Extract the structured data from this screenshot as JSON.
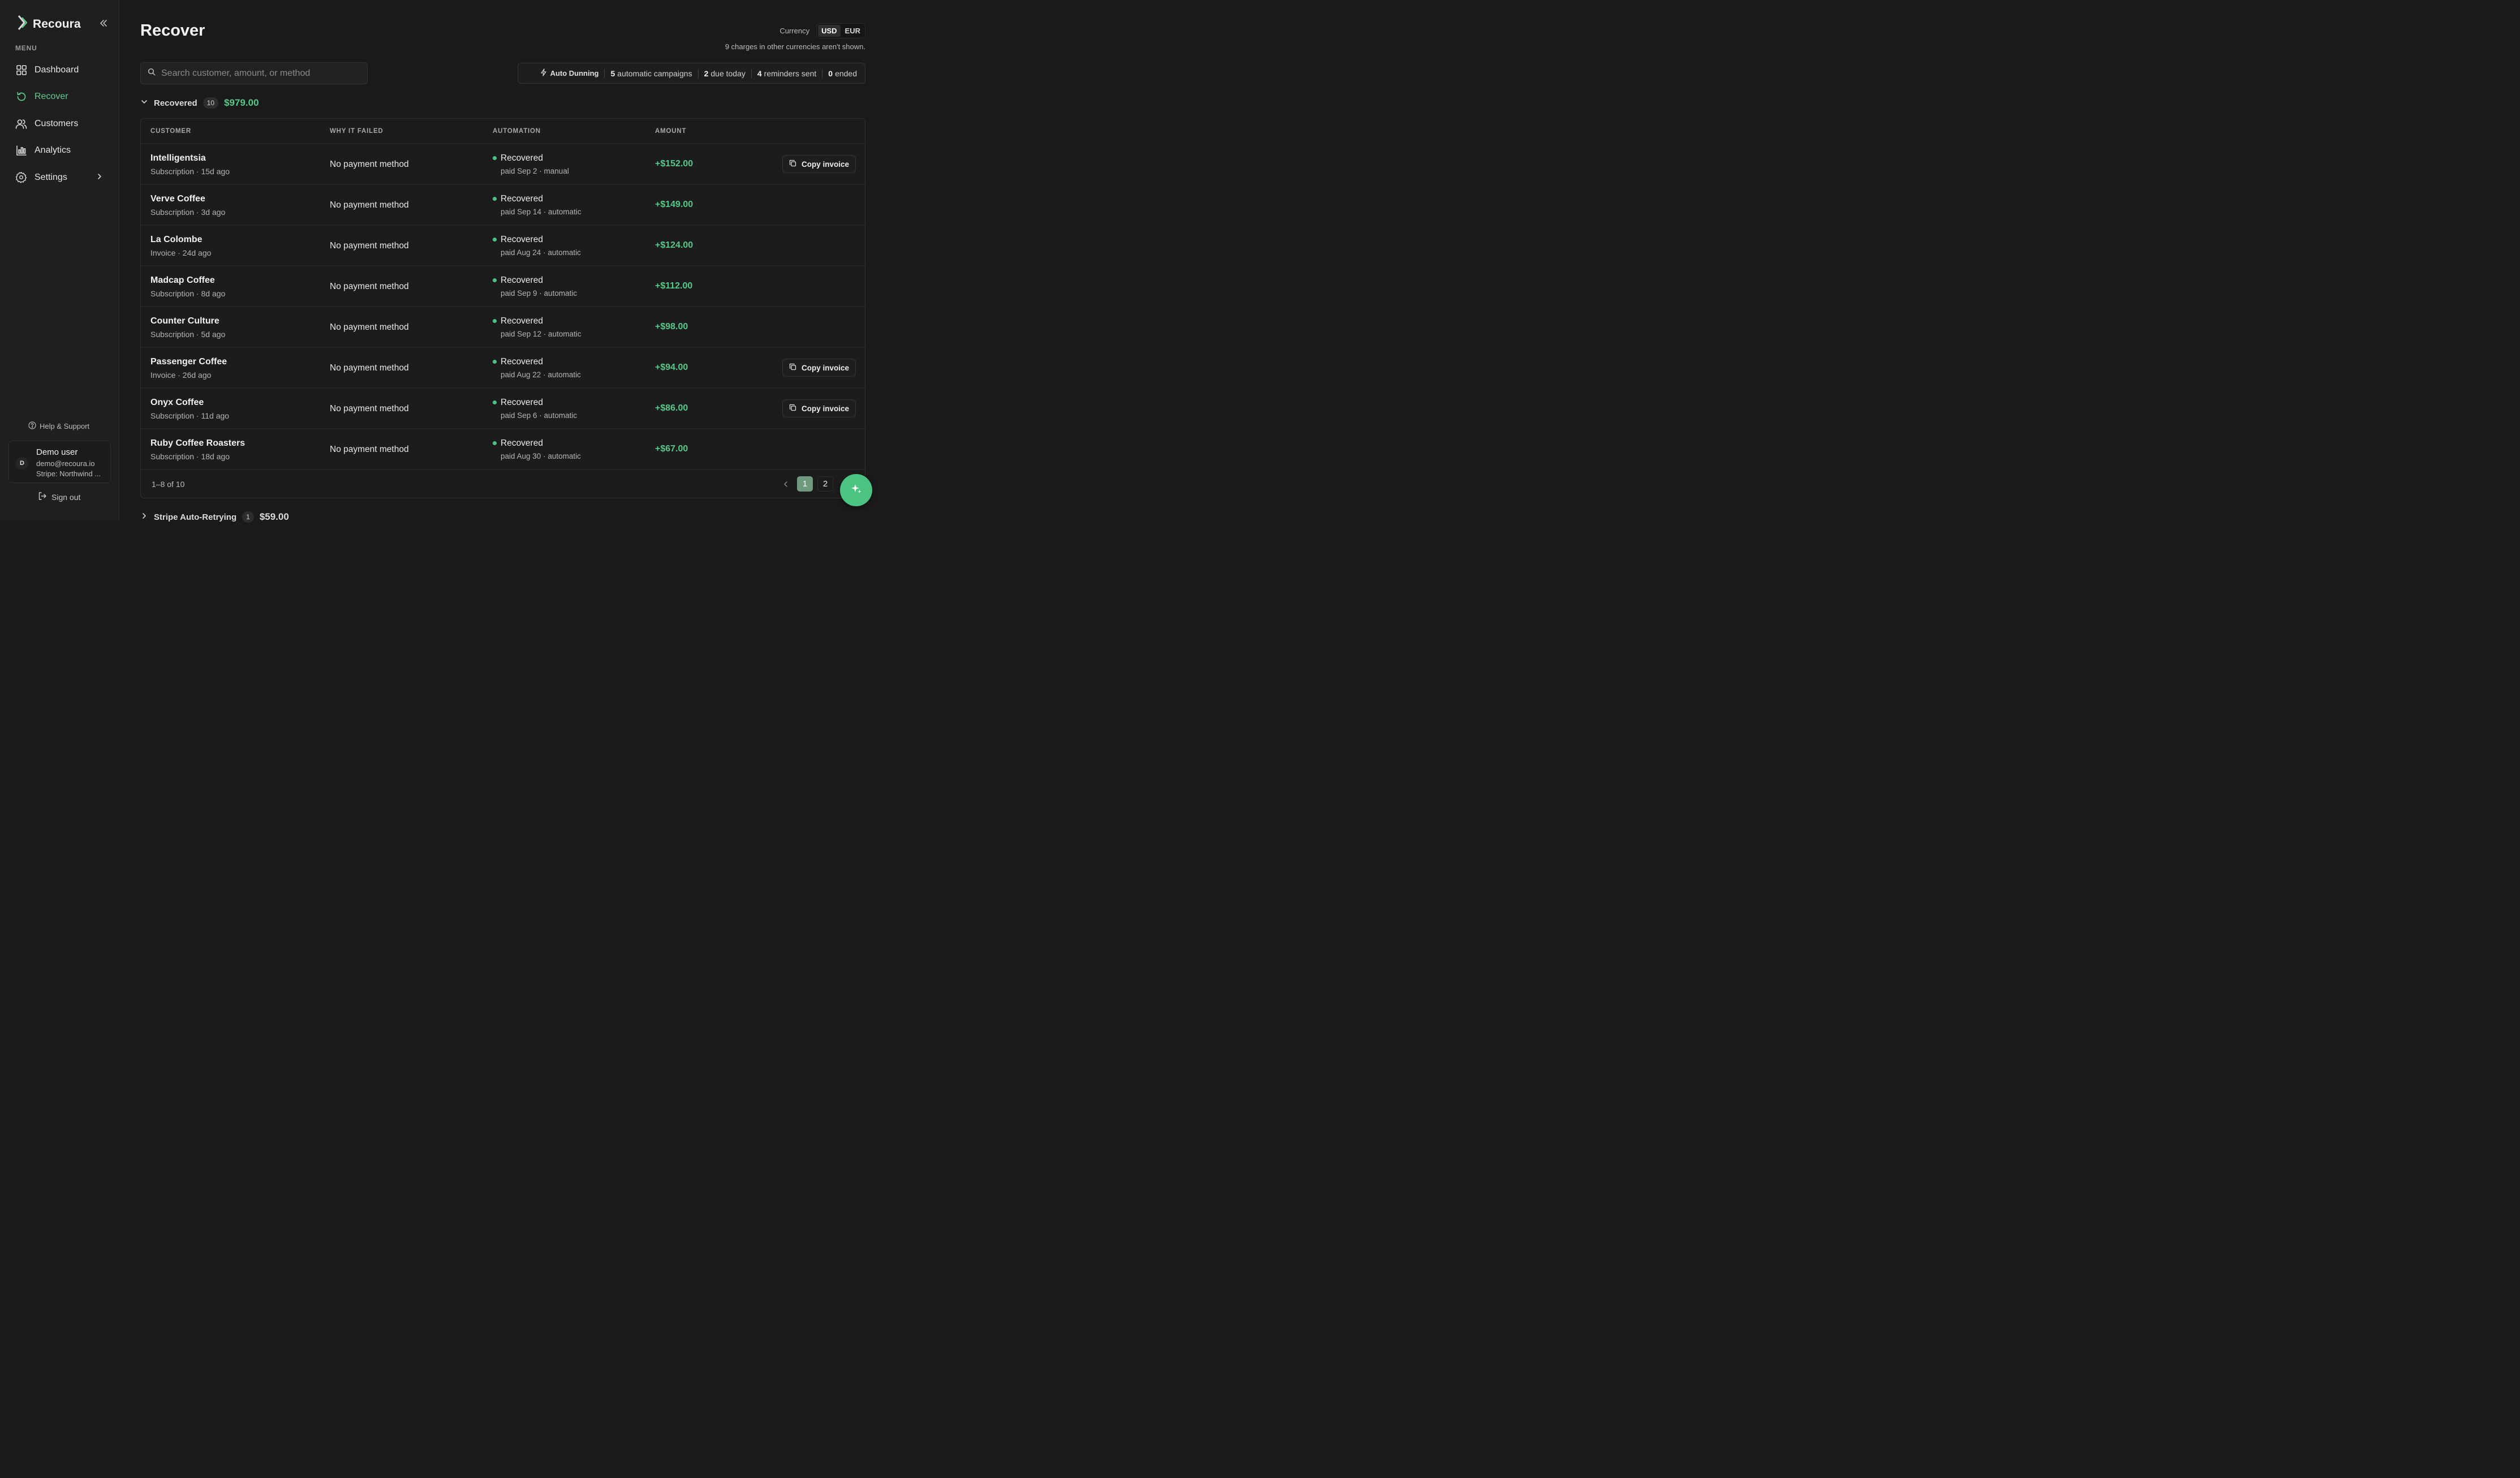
{
  "brand": {
    "name": "Recoura"
  },
  "sidebar": {
    "menu_label": "MENU",
    "items": [
      {
        "label": "Dashboard",
        "icon": "grid-icon"
      },
      {
        "label": "Recover",
        "icon": "refresh-icon"
      },
      {
        "label": "Customers",
        "icon": "users-icon"
      },
      {
        "label": "Analytics",
        "icon": "bar-chart-icon"
      },
      {
        "label": "Settings",
        "icon": "gear-icon"
      }
    ],
    "active": "Recover",
    "help_label": "Help & Support",
    "user": {
      "initial": "D",
      "name": "Demo user",
      "email": "demo@recoura.io",
      "stripe": "Stripe: Northwind ..."
    },
    "signout_label": "Sign out"
  },
  "page": {
    "title": "Recover",
    "currency": {
      "label": "Currency",
      "options": [
        "USD",
        "EUR"
      ],
      "selected": "USD",
      "note": "9 charges in other currencies aren't shown."
    },
    "search": {
      "placeholder": "Search customer, amount, or method",
      "value": ""
    },
    "dunning": {
      "label": "Auto Dunning",
      "campaigns_count": "5",
      "campaigns_text": "automatic campaigns",
      "due_count": "2",
      "due_text": "due today",
      "reminders_count": "4",
      "reminders_text": "reminders sent",
      "ended_count": "0",
      "ended_text": "ended"
    }
  },
  "groups": [
    {
      "title": "Recovered",
      "count": "10",
      "total": "$979.00",
      "expanded": true
    },
    {
      "title": "Stripe Auto-Retrying",
      "count": "1",
      "total": "$59.00",
      "expanded": false
    }
  ],
  "table": {
    "columns": [
      "CUSTOMER",
      "WHY IT FAILED",
      "AUTOMATION",
      "AMOUNT"
    ],
    "copy_label": "Copy invoice",
    "rows": [
      {
        "customer": "Intelligentsia",
        "meta": "Subscription · 15d ago",
        "failed": "No payment method",
        "status": "Recovered",
        "auto_meta": "paid Sep 2 · manual",
        "amount": "+$152.00",
        "copy": true
      },
      {
        "customer": "Verve Coffee",
        "meta": "Subscription · 3d ago",
        "failed": "No payment method",
        "status": "Recovered",
        "auto_meta": "paid Sep 14 · automatic",
        "amount": "+$149.00",
        "copy": false
      },
      {
        "customer": "La Colombe",
        "meta": "Invoice · 24d ago",
        "failed": "No payment method",
        "status": "Recovered",
        "auto_meta": "paid Aug 24 · automatic",
        "amount": "+$124.00",
        "copy": false
      },
      {
        "customer": "Madcap Coffee",
        "meta": "Subscription · 8d ago",
        "failed": "No payment method",
        "status": "Recovered",
        "auto_meta": "paid Sep 9 · automatic",
        "amount": "+$112.00",
        "copy": false
      },
      {
        "customer": "Counter Culture",
        "meta": "Subscription · 5d ago",
        "failed": "No payment method",
        "status": "Recovered",
        "auto_meta": "paid Sep 12 · automatic",
        "amount": "+$98.00",
        "copy": false
      },
      {
        "customer": "Passenger Coffee",
        "meta": "Invoice · 26d ago",
        "failed": "No payment method",
        "status": "Recovered",
        "auto_meta": "paid Aug 22 · automatic",
        "amount": "+$94.00",
        "copy": true
      },
      {
        "customer": "Onyx Coffee",
        "meta": "Subscription · 11d ago",
        "failed": "No payment method",
        "status": "Recovered",
        "auto_meta": "paid Sep 6 · automatic",
        "amount": "+$86.00",
        "copy": true
      },
      {
        "customer": "Ruby Coffee Roasters",
        "meta": "Subscription · 18d ago",
        "failed": "No payment method",
        "status": "Recovered",
        "auto_meta": "paid Aug 30 · automatic",
        "amount": "+$67.00",
        "copy": false
      }
    ],
    "pagination": {
      "range": "1–8 of 10",
      "pages": [
        "1",
        "2"
      ],
      "current": "1"
    }
  },
  "colors": {
    "accent": "#4cc481",
    "background": "#1a1a1a",
    "sidebar": "#1f1f1f"
  }
}
